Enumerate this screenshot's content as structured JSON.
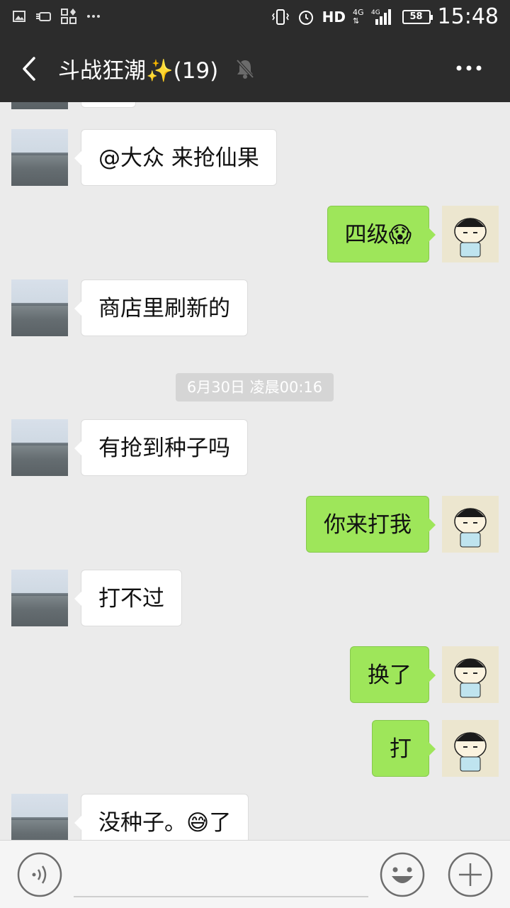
{
  "status_bar": {
    "network": "HD",
    "battery": "58",
    "time": "15:48"
  },
  "header": {
    "title": "斗战狂潮✨(19)"
  },
  "messages": [
    {
      "side": "left",
      "text": "@大众  来抢仙果"
    },
    {
      "side": "right",
      "text": "四级😱"
    },
    {
      "side": "left",
      "text": "商店里刷新的"
    },
    {
      "side": "left",
      "text": "有抢到种子吗"
    },
    {
      "side": "right",
      "text": "你来打我"
    },
    {
      "side": "left",
      "text": "打不过"
    },
    {
      "side": "right",
      "text": "换了"
    },
    {
      "side": "right",
      "text": "打"
    },
    {
      "side": "left",
      "text": "没种子。😅了"
    }
  ],
  "timestamp": "6月30日 凌晨00:16",
  "colors": {
    "bar": "#2c2c2c",
    "background": "#ebebeb",
    "bubble_self": "#9ee65a",
    "bubble_other": "#ffffff"
  },
  "icons": [
    "back-icon",
    "mute-bell-icon",
    "more-icon",
    "voice-icon",
    "emoji-icon",
    "plus-icon"
  ]
}
